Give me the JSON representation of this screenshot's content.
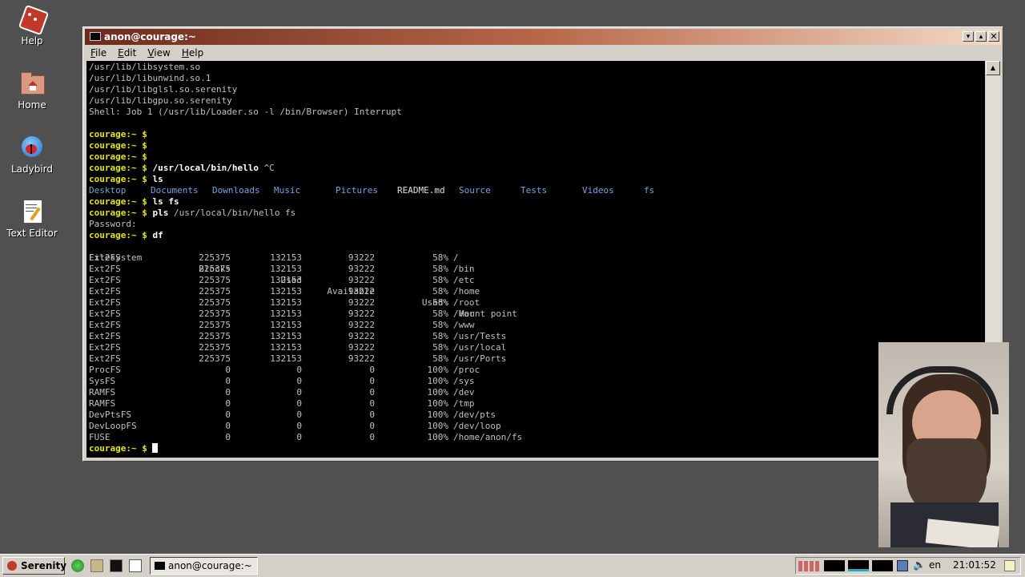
{
  "desktop": {
    "icons": [
      {
        "label": "Help",
        "icon": "help-icon"
      },
      {
        "label": "Home",
        "icon": "home-folder-icon"
      },
      {
        "label": "Ladybird",
        "icon": "ladybird-browser-icon"
      },
      {
        "label": "Text Editor",
        "icon": "text-editor-icon"
      }
    ]
  },
  "window": {
    "title": "anon@courage:~",
    "menu": [
      "File",
      "Edit",
      "View",
      "Help"
    ]
  },
  "terminal": {
    "prompt": "courage:~ $",
    "preamble": [
      "/usr/lib/libsystem.so",
      "/usr/lib/libunwind.so.1",
      "/usr/lib/libglsl.so.serenity",
      "/usr/lib/libgpu.so.serenity",
      "Shell: Job 1 (/usr/lib/Loader.so -l /bin/Browser) Interrupt"
    ],
    "hello_cmd": "/usr/local/bin/hello",
    "hello_interrupt": "^C",
    "ls_cmd": "ls",
    "ls_entries": [
      "Desktop",
      "Documents",
      "Downloads",
      "Music",
      "Pictures",
      "README.md",
      "Source",
      "Tests",
      "Videos",
      "fs"
    ],
    "ls_fs_cmd": "ls fs",
    "pls_cmd": "pls",
    "pls_args": "/usr/local/bin/hello fs",
    "password_prompt": "Password:",
    "df_cmd": "df",
    "df_headers": [
      "Filesystem",
      "Blocks",
      "Used",
      "Available",
      "Used%",
      "Mount point"
    ],
    "df_rows": [
      [
        "Ext2FS",
        "225375",
        "132153",
        "93222",
        "58%",
        "/"
      ],
      [
        "Ext2FS",
        "225375",
        "132153",
        "93222",
        "58%",
        "/bin"
      ],
      [
        "Ext2FS",
        "225375",
        "132153",
        "93222",
        "58%",
        "/etc"
      ],
      [
        "Ext2FS",
        "225375",
        "132153",
        "93222",
        "58%",
        "/home"
      ],
      [
        "Ext2FS",
        "225375",
        "132153",
        "93222",
        "58%",
        "/root"
      ],
      [
        "Ext2FS",
        "225375",
        "132153",
        "93222",
        "58%",
        "/var"
      ],
      [
        "Ext2FS",
        "225375",
        "132153",
        "93222",
        "58%",
        "/www"
      ],
      [
        "Ext2FS",
        "225375",
        "132153",
        "93222",
        "58%",
        "/usr/Tests"
      ],
      [
        "Ext2FS",
        "225375",
        "132153",
        "93222",
        "58%",
        "/usr/local"
      ],
      [
        "Ext2FS",
        "225375",
        "132153",
        "93222",
        "58%",
        "/usr/Ports"
      ],
      [
        "ProcFS",
        "0",
        "0",
        "0",
        "100%",
        "/proc"
      ],
      [
        "SysFS",
        "0",
        "0",
        "0",
        "100%",
        "/sys"
      ],
      [
        "RAMFS",
        "0",
        "0",
        "0",
        "100%",
        "/dev"
      ],
      [
        "RAMFS",
        "0",
        "0",
        "0",
        "100%",
        "/tmp"
      ],
      [
        "DevPtsFS",
        "0",
        "0",
        "0",
        "100%",
        "/dev/pts"
      ],
      [
        "DevLoopFS",
        "0",
        "0",
        "0",
        "100%",
        "/dev/loop"
      ],
      [
        "FUSE",
        "0",
        "0",
        "0",
        "100%",
        "/home/anon/fs"
      ]
    ]
  },
  "taskbar": {
    "start_label": "Serenity",
    "task_label": "anon@courage:~",
    "keyboard_layout": "en",
    "clock": "21:01:52"
  },
  "colors": {
    "prompt": "#e6e600",
    "directory": "#6ea6e0",
    "terminal_bg": "#000000",
    "desktop_bg": "#505050"
  }
}
